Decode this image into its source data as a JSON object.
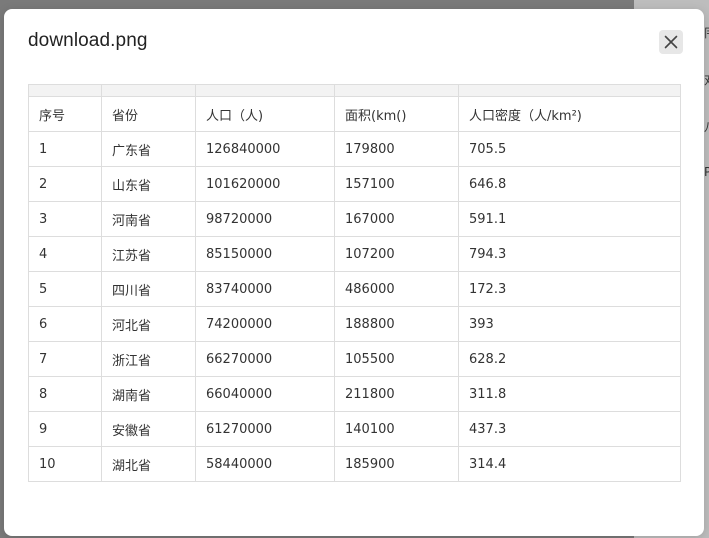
{
  "dialog": {
    "title": "download.png",
    "close_icon": "close-icon"
  },
  "table": {
    "headers": [
      "序号",
      "省份",
      "人口（人)",
      "面积(km()",
      "人口密度（人/km²)"
    ],
    "rows": [
      [
        "1",
        "广东省",
        "126840000",
        "179800",
        "705.5"
      ],
      [
        "2",
        "山东省",
        "101620000",
        "157100",
        "646.8"
      ],
      [
        "3",
        "河南省",
        "98720000",
        "167000",
        "591.1"
      ],
      [
        "4",
        "江苏省",
        "85150000",
        "107200",
        "794.3"
      ],
      [
        "5",
        "四川省",
        "83740000",
        "486000",
        "172.3"
      ],
      [
        "6",
        "河北省",
        "74200000",
        "188800",
        "393"
      ],
      [
        "7",
        "浙江省",
        "66270000",
        "105500",
        "628.2"
      ],
      [
        "8",
        "湖南省",
        "66040000",
        "211800",
        "311.8"
      ],
      [
        "9",
        "安徽省",
        "61270000",
        "140100",
        "437.3"
      ],
      [
        "10",
        "湖北省",
        "58440000",
        "185900",
        "314.4"
      ]
    ]
  },
  "background_page": {
    "fragments": [
      "冃",
      "对",
      "八",
      "P"
    ]
  }
}
